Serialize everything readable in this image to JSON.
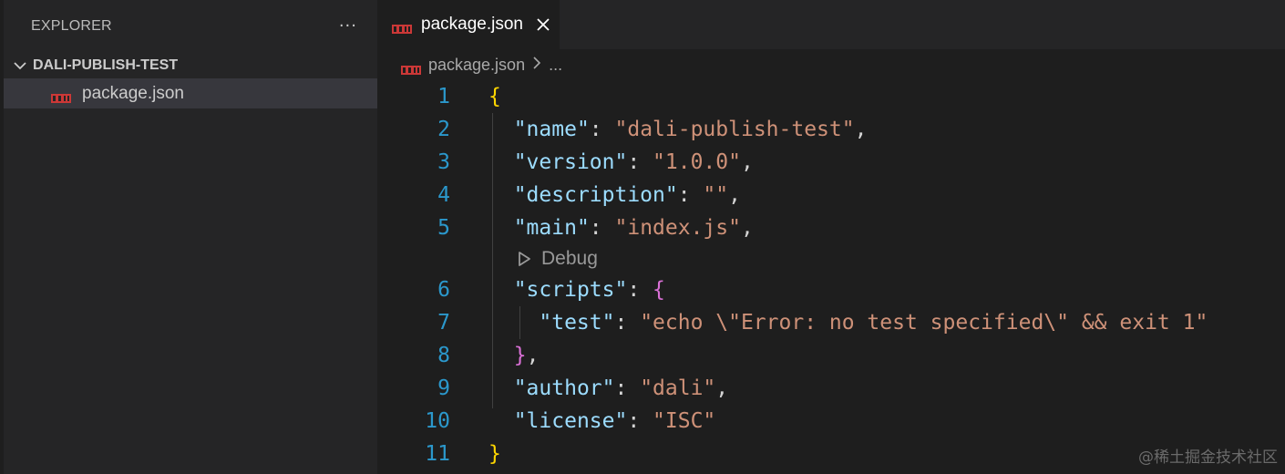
{
  "sidebar": {
    "title": "EXPLORER",
    "more_icon": "ellipsis-icon",
    "folder": "DALI-PUBLISH-TEST",
    "files": [
      {
        "label": "package.json",
        "icon": "npm-icon"
      }
    ]
  },
  "tab": {
    "label": "package.json",
    "icon": "npm-icon"
  },
  "breadcrumb": {
    "file": "package.json",
    "more": "..."
  },
  "codelens": {
    "label": "Debug"
  },
  "code_lines": [
    {
      "num": "1",
      "parts": [
        [
          "b1",
          "{"
        ]
      ]
    },
    {
      "num": "2",
      "parts": [
        [
          "p",
          "  "
        ],
        [
          "k",
          "\"name\""
        ],
        [
          "p",
          ": "
        ],
        [
          "s",
          "\"dali-publish-test\""
        ],
        [
          "p",
          ","
        ]
      ]
    },
    {
      "num": "3",
      "parts": [
        [
          "p",
          "  "
        ],
        [
          "k",
          "\"version\""
        ],
        [
          "p",
          ": "
        ],
        [
          "s",
          "\"1.0.0\""
        ],
        [
          "p",
          ","
        ]
      ]
    },
    {
      "num": "4",
      "parts": [
        [
          "p",
          "  "
        ],
        [
          "k",
          "\"description\""
        ],
        [
          "p",
          ": "
        ],
        [
          "s",
          "\"\""
        ],
        [
          "p",
          ","
        ]
      ]
    },
    {
      "num": "5",
      "parts": [
        [
          "p",
          "  "
        ],
        [
          "k",
          "\"main\""
        ],
        [
          "p",
          ": "
        ],
        [
          "s",
          "\"index.js\""
        ],
        [
          "p",
          ","
        ]
      ]
    },
    {
      "num": "6",
      "parts": [
        [
          "p",
          "  "
        ],
        [
          "k",
          "\"scripts\""
        ],
        [
          "p",
          ": "
        ],
        [
          "b2",
          "{"
        ]
      ]
    },
    {
      "num": "7",
      "parts": [
        [
          "p",
          "    "
        ],
        [
          "k",
          "\"test\""
        ],
        [
          "p",
          ": "
        ],
        [
          "s",
          "\"echo \\\"Error: no test specified\\\" && exit 1\""
        ]
      ]
    },
    {
      "num": "8",
      "parts": [
        [
          "p",
          "  "
        ],
        [
          "b2",
          "}"
        ],
        [
          "p",
          ","
        ]
      ]
    },
    {
      "num": "9",
      "parts": [
        [
          "p",
          "  "
        ],
        [
          "k",
          "\"author\""
        ],
        [
          "p",
          ": "
        ],
        [
          "s",
          "\"dali\""
        ],
        [
          "p",
          ","
        ]
      ]
    },
    {
      "num": "10",
      "parts": [
        [
          "p",
          "  "
        ],
        [
          "k",
          "\"license\""
        ],
        [
          "p",
          ": "
        ],
        [
          "s",
          "\"ISC\""
        ]
      ]
    },
    {
      "num": "11",
      "parts": [
        [
          "b1",
          "}"
        ]
      ]
    }
  ],
  "watermark": "@稀土掘金技术社区",
  "colors": {
    "key": "#9cdcfe",
    "string": "#ce9178",
    "bracket_level1": "#ffd700",
    "bracket_level2": "#da70d6",
    "line_number": "#2b98cc",
    "npm_red": "#cb3837"
  }
}
